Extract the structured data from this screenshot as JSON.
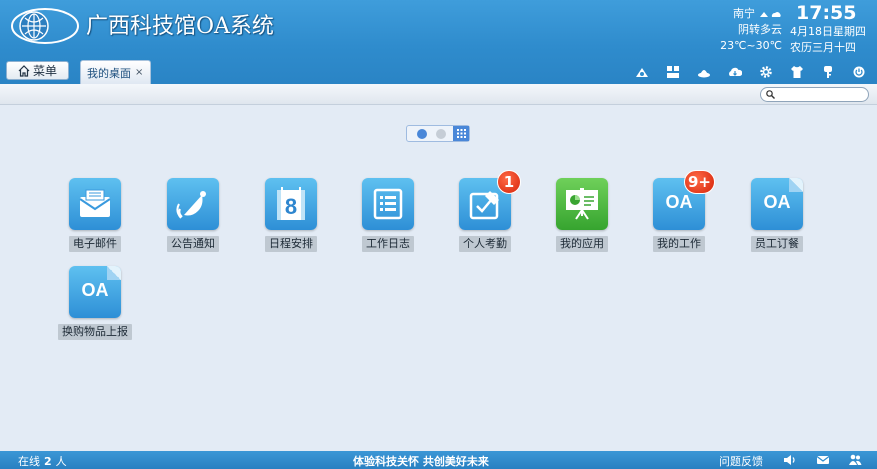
{
  "header": {
    "title": "广西科技馆OA系统",
    "accent_color": "#2f8ccd"
  },
  "weather": {
    "city": "南宁",
    "condition": "阴转多云",
    "temperature": "23℃~30℃"
  },
  "clock": {
    "time": "17:55",
    "date": "4月18日星期四",
    "lunar": "农历三月十四"
  },
  "nav": {
    "menu_label": "菜单",
    "tab_label": "我的桌面",
    "tab_close": "×"
  },
  "toolbar": {
    "icons": [
      "skin-icon",
      "layout-icon",
      "hat-icon",
      "cloud-icon",
      "gear-icon",
      "shirt-icon",
      "key-icon",
      "power-icon"
    ]
  },
  "search": {
    "placeholder": ""
  },
  "desktop": {
    "apps": [
      {
        "label": "电子邮件",
        "icon": "mail-icon"
      },
      {
        "label": "公告通知",
        "icon": "bell-icon"
      },
      {
        "label": "日程安排",
        "icon": "calendar-icon",
        "day": "8"
      },
      {
        "label": "工作日志",
        "icon": "list-icon"
      },
      {
        "label": "个人考勤",
        "icon": "checkin-icon",
        "badge": "1"
      },
      {
        "label": "我的应用",
        "icon": "presentation-icon"
      },
      {
        "label": "我的工作",
        "icon": "oa-doc-icon",
        "badge": "9+",
        "icon_text": "OA"
      },
      {
        "label": "员工订餐",
        "icon": "oa-doc-icon",
        "icon_text": "OA"
      },
      {
        "label": "换购物品上报",
        "icon": "oa-doc-icon",
        "icon_text": "OA"
      }
    ]
  },
  "footer": {
    "online_prefix": "在线",
    "online_count": "2",
    "online_suffix": "人",
    "slogan": "体验科技关怀 共创美好未来",
    "feedback": "问题反馈"
  }
}
